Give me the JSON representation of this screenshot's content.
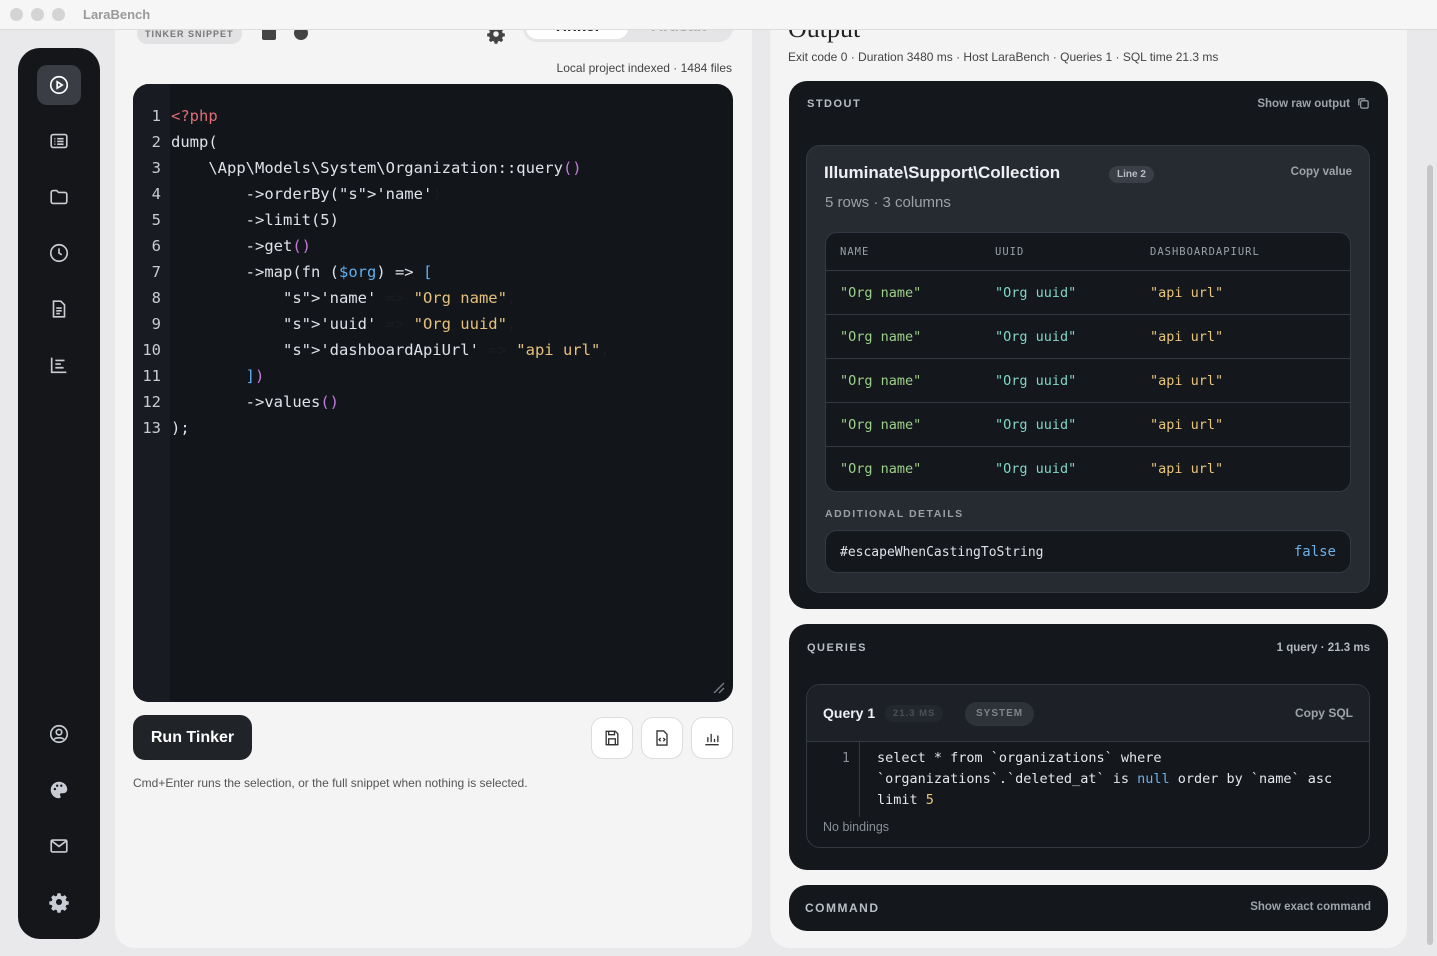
{
  "app": {
    "title": "LaraBench"
  },
  "rail": {
    "top_icons": [
      "play-icon",
      "list-icon",
      "folder-icon",
      "clock-icon",
      "document-icon",
      "chart-icon"
    ],
    "bottom_icons": [
      "user-icon",
      "palette-icon",
      "mail-icon",
      "gear-icon"
    ]
  },
  "left": {
    "snippet_label": "TINKER SNIPPET",
    "tabs": [
      "Tinker",
      "Artisan"
    ],
    "active_tab": "Tinker",
    "indexed": "Local project indexed · 1484 files",
    "run_label": "Run Tinker",
    "hint": "Cmd+Enter runs the selection, or the full snippet when nothing is selected.",
    "code_lines": [
      "<?php",
      "dump(",
      "    \\App\\Models\\System\\Organization::query()",
      "        ->orderBy('name')",
      "        ->limit(5)",
      "        ->get()",
      "        ->map(fn ($org) => [",
      "            'name' => \"Org name\",",
      "            'uuid' => \"Org uuid\",",
      "            'dashboardApiUrl' => \"api url\",",
      "        ])",
      "        ->values()",
      ");"
    ]
  },
  "output": {
    "title": "Output",
    "meta": "Exit code 0 · Duration 3480 ms · Host LaraBench · Queries 1 · SQL time 21.3 ms",
    "stdout": {
      "label": "STDOUT",
      "raw_label": "Show raw output",
      "collection_title": "Illuminate\\Support\\Collection",
      "line_pill": "Line 2",
      "copy_label": "Copy value",
      "summary": "5 rows · 3 columns",
      "columns": [
        "NAME",
        "UUID",
        "DASHBOARDAPIURL"
      ],
      "rows": [
        [
          "\"Org name\"",
          "\"Org uuid\"",
          "\"api url\""
        ],
        [
          "\"Org name\"",
          "\"Org uuid\"",
          "\"api url\""
        ],
        [
          "\"Org name\"",
          "\"Org uuid\"",
          "\"api url\""
        ],
        [
          "\"Org name\"",
          "\"Org uuid\"",
          "\"api url\""
        ],
        [
          "\"Org name\"",
          "\"Org uuid\"",
          "\"api url\""
        ]
      ],
      "additional_label": "ADDITIONAL DETAILS",
      "additional_key": "#escapeWhenCastingToString",
      "additional_value": "false"
    },
    "queries": {
      "label": "QUERIES",
      "summary": "1 query · 21.3 ms",
      "query_title": "Query 1",
      "time_pill": "21.3 MS",
      "conn_pill": "SYSTEM",
      "copy_label": "Copy SQL",
      "line_no": "1",
      "sql_1": "select * from `organizations` where",
      "sql_2a": "`organizations`.`deleted_at` is ",
      "sql_null": "null",
      "sql_2b": " order by `name` asc",
      "sql_3a": "limit ",
      "sql_num": "5",
      "bindings": "No bindings"
    },
    "command": {
      "label": "COMMAND",
      "action": "Show exact command"
    }
  }
}
